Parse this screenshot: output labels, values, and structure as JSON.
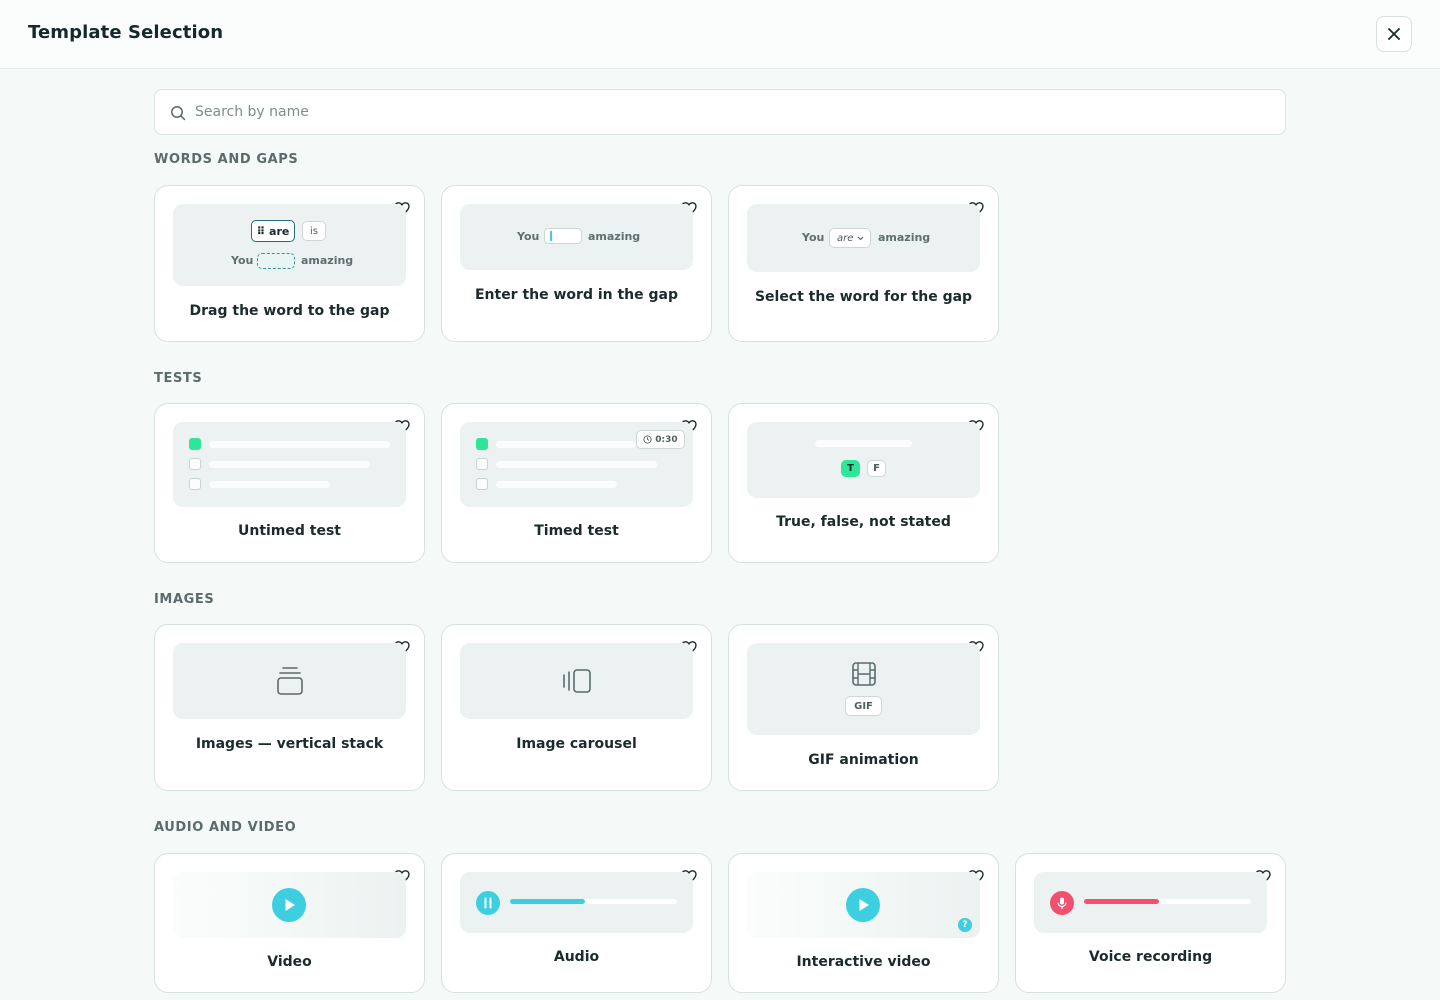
{
  "header": {
    "title": "Template Selection",
    "close_icon": "close-icon"
  },
  "search": {
    "placeholder": "Search by name",
    "value": ""
  },
  "colors": {
    "accent_green": "#2ee69a",
    "accent_cyan": "#3dcfe0",
    "accent_pink": "#f2506e"
  },
  "sections": {
    "words": {
      "title": "WORDS AND GAPS",
      "drag": {
        "label": "Drag the word to the gap",
        "chip1": "⠿ are",
        "chip2": "is",
        "left": "You",
        "right": "amazing"
      },
      "enter": {
        "label": "Enter the word in the gap",
        "left": "You",
        "right": "amazing"
      },
      "select": {
        "label": "Select the word for the gap",
        "left": "You",
        "option": "are",
        "right": "amazing"
      }
    },
    "tests": {
      "title": "TESTS",
      "untimed": {
        "label": "Untimed test"
      },
      "timed": {
        "label": "Timed test",
        "timer": "0:30"
      },
      "tf": {
        "label": "True, false, not stated",
        "true_chip": "T",
        "false_chip": "F"
      }
    },
    "images": {
      "title": "IMAGES",
      "stack": {
        "label": "Images — vertical stack"
      },
      "carousel": {
        "label": "Image carousel"
      },
      "gif": {
        "label": "GIF animation",
        "badge": "GIF"
      }
    },
    "media": {
      "title": "AUDIO AND VIDEO",
      "video": {
        "label": "Video"
      },
      "audio": {
        "label": "Audio",
        "progress": 0.45
      },
      "interactive": {
        "label": "Interactive video",
        "badge": "?"
      },
      "voice": {
        "label": "Voice recording",
        "progress": 0.45
      }
    }
  }
}
